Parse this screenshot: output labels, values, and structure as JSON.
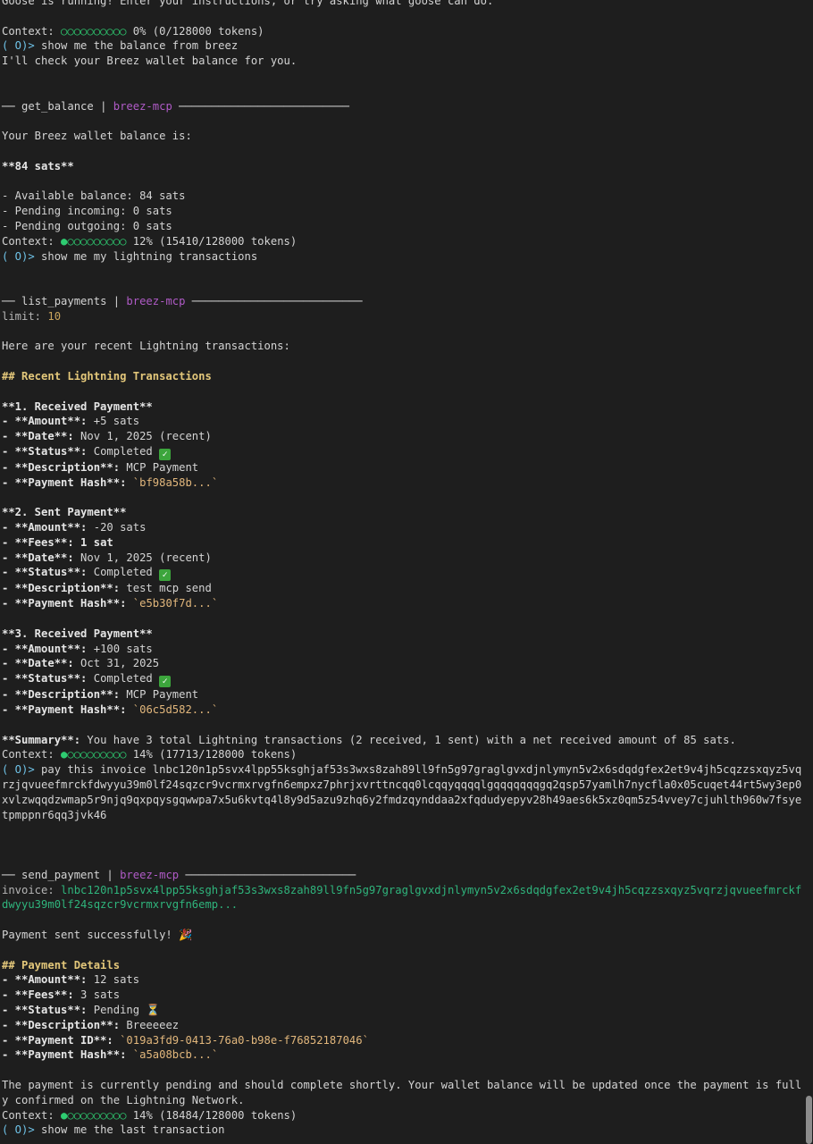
{
  "intro": "Goose is running! Enter your instructions, or try asking what goose can do.",
  "context_label": "Context:",
  "prompt_symbol": "( O)>",
  "contexts": {
    "c1": {
      "dots": "○○○○○○○○○○",
      "text": "0% (0/128000 tokens)"
    },
    "c2": {
      "dots": "●○○○○○○○○○",
      "text": "12% (15410/128000 tokens)"
    },
    "c3": {
      "dots": "●○○○○○○○○○",
      "text": "14% (17713/128000 tokens)"
    },
    "c4": {
      "dots": "●○○○○○○○○○",
      "text": "14% (18484/128000 tokens)"
    }
  },
  "prompts": {
    "p1": "show me the balance from breez",
    "p2": "show me my lightning transactions",
    "p3": "pay this invoice lnbc120n1p5svx4lpp55ksghjaf53s3wxs8zah89ll9fn5g97graglgvxdjnlymyn5v2x6sdqdgfex2et9v4jh5cqzzsxqyz5vqrzjqvueefmrckfdwyyu39m0lf24sqzcr9vcrmxrvgfn6empxz7phrjxvrttncqq0lcqqyqqqqlgqqqqqqqgq2qsp57yamlh7nycfla0x05cuqet44rt5wy3ep0xvlzwqqdzwmap5r9njq9qxpqysgqwwpa7x5u6kvtq4l8y9d5azu9zhq6y2fmdzqynddaa2xfqdudyepyv28h49aes6k5xz0qm5z54vvey7cjuhlth960w7fsyetpmppnr6qq3jvk46",
    "p4": "show me the last transaction"
  },
  "responses": {
    "r1": "I'll check your Breez wallet balance for you."
  },
  "tools": {
    "t1": {
      "name": "get_balance",
      "sep": " | ",
      "server": "breez-mcp",
      "lead": "── ",
      "trail": " ──────────────────────────"
    },
    "t2": {
      "name": "list_payments",
      "sep": " | ",
      "server": "breez-mcp",
      "lead": "── ",
      "trail": " ──────────────────────────",
      "param_key": "limit:",
      "param_value": "10"
    },
    "t3": {
      "name": "send_payment",
      "sep": " | ",
      "server": "breez-mcp",
      "lead": "── ",
      "trail": " ──────────────────────────",
      "param_key": "invoice:",
      "param_value": "lnbc120n1p5svx4lpp55ksghjaf53s3wxs8zah89ll9fn5g97graglgvxdjnlymyn5v2x6sdqdgfex2et9v4jh5cqzzsxqyz5vqrzjqvueefmrckfdwyyu39m0lf24sqzcr9vcrmxrvgfn6emp..."
    }
  },
  "balance": {
    "intro": "Your Breez wallet balance is:",
    "total": "**84 sats**",
    "available": "- Available balance: 84 sats",
    "incoming": "- Pending incoming: 0 sats",
    "outgoing": "- Pending outgoing: 0 sats"
  },
  "transactions": {
    "intro": "Here are your recent Lightning transactions:",
    "heading": "## Recent Lightning Transactions",
    "k_amount": "- **Amount**:",
    "k_fees": "- **Fees**:",
    "k_date": "- **Date**:",
    "k_status": "- **Status**:",
    "k_description": "- **Description**:",
    "k_hash": "- **Payment Hash**:",
    "items": [
      {
        "title": "**1. Received Payment**",
        "amount": " +5 sats",
        "date": " Nov 1, 2025 (recent)",
        "status": " Completed ",
        "description": " MCP Payment",
        "hash": "`bf98a58b...`"
      },
      {
        "title": "**2. Sent Payment**",
        "amount": " -20 sats",
        "fees": " 1 sat",
        "date": " Nov 1, 2025 (recent)",
        "status": " Completed ",
        "description": " test mcp send",
        "hash": "`e5b30f7d...`"
      },
      {
        "title": "**3. Received Payment**",
        "amount": " +100 sats",
        "date": " Oct 31, 2025",
        "status": " Completed ",
        "description": " MCP Payment",
        "hash": "`06c5d582...`"
      }
    ],
    "summary_key": "**Summary**:",
    "summary_text": " You have 3 total Lightning transactions (2 received, 1 sent) with a net received amount of 85 sats."
  },
  "payment": {
    "success": "Payment sent successfully! ",
    "heading": "## Payment Details",
    "k_amount": "- **Amount**:",
    "amount": " 12 sats",
    "k_fees": "- **Fees**:",
    "fees": " 3 sats",
    "k_status": "- **Status**:",
    "status": " Pending ",
    "k_description": "- **Description**:",
    "description": " Breeeeez",
    "k_id": "- **Payment ID**:",
    "id": "`019a3fd9-0413-76a0-b98e-f76852187046`",
    "k_hash": "- **Payment Hash**:",
    "hash": "`a5a08bcb...`",
    "note": "The payment is currently pending and should complete shortly. Your wallet balance will be updated once the payment is fully confirmed on the Lightning Network."
  }
}
